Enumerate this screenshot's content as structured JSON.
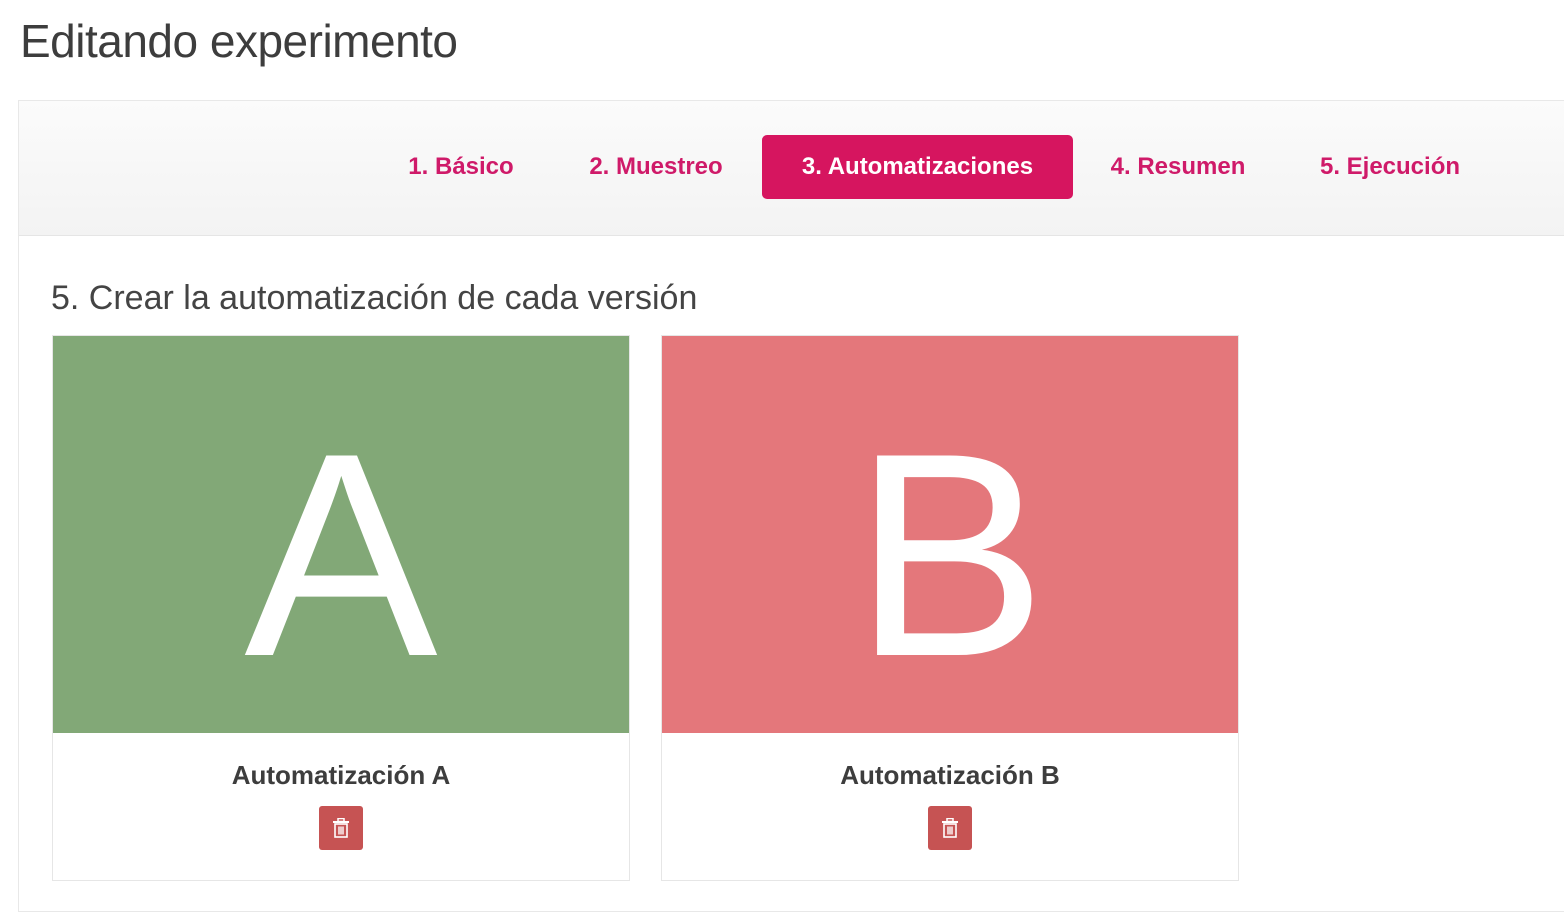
{
  "page": {
    "title": "Editando experimento"
  },
  "tabs": [
    {
      "label": "1. Básico",
      "active": false
    },
    {
      "label": "2. Muestreo",
      "active": false
    },
    {
      "label": "3. Automatizaciones",
      "active": true
    },
    {
      "label": "4. Resumen",
      "active": false
    },
    {
      "label": "5. Ejecución",
      "active": false
    }
  ],
  "section": {
    "title": "5. Crear la automatización de cada versión"
  },
  "cards": [
    {
      "letter": "A",
      "label": "Automatización A",
      "color": "#82a877",
      "delete_icon": "trash-icon"
    },
    {
      "letter": "B",
      "label": "Automatización B",
      "color": "#e4777b",
      "delete_icon": "trash-icon"
    }
  ],
  "colors": {
    "accent": "#d6155f",
    "delete": "#c65353"
  }
}
